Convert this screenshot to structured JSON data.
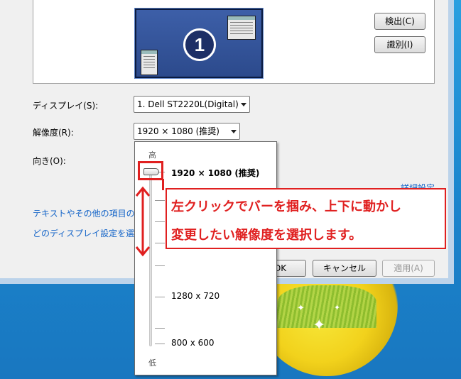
{
  "desktop": {
    "wallpaper": "yellow-flower"
  },
  "window": {
    "detect_button": "検出(C)",
    "identify_button": "識別(I)",
    "monitor_number": "1",
    "display_label": "ディスプレイ(S):",
    "display_value": "1. Dell ST2220L(Digital)",
    "resolution_label": "解像度(R):",
    "resolution_value": "1920 × 1080 (推奨)",
    "orientation_label": "向き(O):",
    "advanced_link": "詳細設定",
    "text_size_link": "テキストやその他の項目の",
    "which_display_link": "どのディスプレイ設定を選",
    "ok_button": "OK",
    "cancel_button": "キャンセル",
    "apply_button": "適用(A)"
  },
  "resolution_slider": {
    "high_label": "高",
    "low_label": "低",
    "current": "1920 × 1080 (推奨)",
    "mid_option": "1280 x 720",
    "low_option": "800 x 600",
    "position_fraction": 1.0
  },
  "annotation": {
    "line1": "左クリックでバーを掴み、上下に動かし",
    "line2": "変更したい解像度を選択します。",
    "color": "#e02020"
  }
}
